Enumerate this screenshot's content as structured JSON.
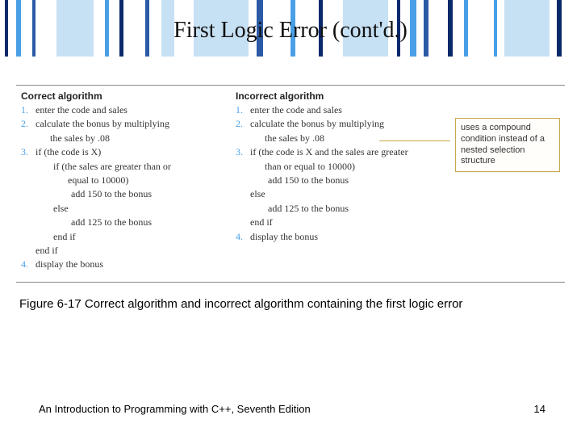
{
  "title": "First Logic Error (cont'd.)",
  "figure": {
    "correct": {
      "heading": "Correct algorithm",
      "lines": [
        {
          "num": "1.",
          "text": "enter the code and sales",
          "indent": 0
        },
        {
          "num": "2.",
          "text": "calculate the bonus by multiplying",
          "indent": 0
        },
        {
          "num": "",
          "text": "the sales by .08",
          "indent": 0,
          "cont": true
        },
        {
          "num": "3.",
          "text": "if (the code is X)",
          "indent": 0
        },
        {
          "num": "",
          "text": "if (the sales are greater than or",
          "indent": 1
        },
        {
          "num": "",
          "text": "equal to 10000)",
          "indent": 1,
          "cont": true
        },
        {
          "num": "",
          "text": "add 150 to the bonus",
          "indent": 2
        },
        {
          "num": "",
          "text": "else",
          "indent": 1
        },
        {
          "num": "",
          "text": "add 125 to the bonus",
          "indent": 2
        },
        {
          "num": "",
          "text": "end if",
          "indent": 1
        },
        {
          "num": "",
          "text": "end if",
          "indent": 0,
          "plain": true
        },
        {
          "num": "4.",
          "text": "display the bonus",
          "indent": 0
        }
      ]
    },
    "incorrect": {
      "heading": "Incorrect algorithm",
      "lines": [
        {
          "num": "1.",
          "text": "enter the code and sales",
          "indent": 0
        },
        {
          "num": "2.",
          "text": "calculate the bonus by multiplying",
          "indent": 0
        },
        {
          "num": "",
          "text": "the sales by .08",
          "indent": 0,
          "cont": true
        },
        {
          "num": "3.",
          "text": "if (the code is X and the sales are greater",
          "indent": 0
        },
        {
          "num": "",
          "text": "than or equal to 10000)",
          "indent": 0,
          "cont": true
        },
        {
          "num": "",
          "text": "add 150 to the bonus",
          "indent": 1
        },
        {
          "num": "",
          "text": "else",
          "indent": 0,
          "plain": true
        },
        {
          "num": "",
          "text": "add 125 to the bonus",
          "indent": 1
        },
        {
          "num": "",
          "text": "end if",
          "indent": 0,
          "plain": true
        },
        {
          "num": "4.",
          "text": "display the bonus",
          "indent": 0
        }
      ]
    },
    "callout": "uses a compound condition instead of a nested selection structure"
  },
  "caption": "Figure 6-17 Correct algorithm and incorrect algorithm containing the first logic error",
  "footer": "An Introduction to Programming with C++, Seventh Edition",
  "page": "14"
}
